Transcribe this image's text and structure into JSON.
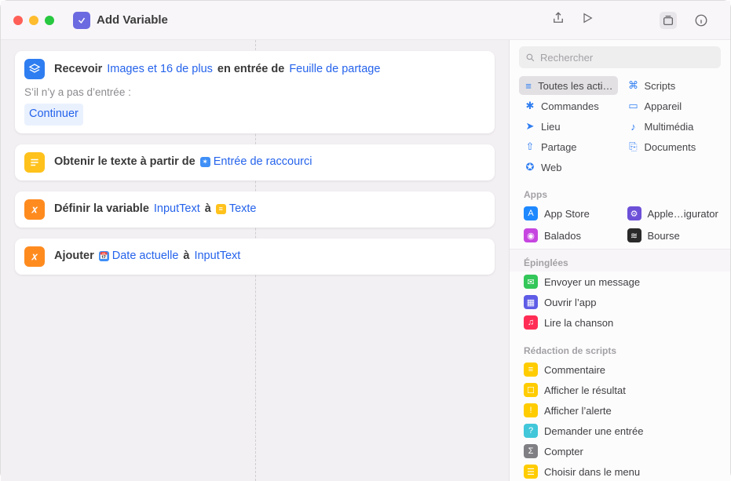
{
  "title": "Add Variable",
  "search": {
    "placeholder": "Rechercher"
  },
  "card_receive": {
    "verb": "Recevoir",
    "types": "Images et 16 de plus",
    "mid": "en entrée de",
    "source": "Feuille de partage",
    "noinput_label": "S’il n’y a pas d’entrée :",
    "noinput_action": "Continuer"
  },
  "card_gettext": {
    "verb": "Obtenir le texte à partir de",
    "input": "Entrée de raccourci"
  },
  "card_setvar": {
    "verb": "Définir la variable",
    "var": "InputText",
    "to": "à",
    "value": "Texte"
  },
  "card_add": {
    "verb": "Ajouter",
    "value": "Date actuelle",
    "to": "à",
    "var": "InputText"
  },
  "categories": [
    {
      "label": "Toutes les acti…",
      "icon": "≡",
      "active": true
    },
    {
      "label": "Scripts",
      "icon": "⌘"
    },
    {
      "label": "Commandes",
      "icon": "✱"
    },
    {
      "label": "Appareil",
      "icon": "▭"
    },
    {
      "label": "Lieu",
      "icon": "➤"
    },
    {
      "label": "Multimédia",
      "icon": "♪"
    },
    {
      "label": "Partage",
      "icon": "⇧"
    },
    {
      "label": "Documents",
      "icon": "⎘"
    },
    {
      "label": "Web",
      "icon": "✪"
    }
  ],
  "section_apps": "Apps",
  "apps": [
    {
      "label": "App Store",
      "icon": "A",
      "color": "#1e88ff"
    },
    {
      "label": "Apple…igurator",
      "icon": "⚙",
      "color": "#6d50d8"
    },
    {
      "label": "Balados",
      "icon": "◉",
      "color": "#c646e0"
    },
    {
      "label": "Bourse",
      "icon": "≋",
      "color": "#2a2a2b"
    }
  ],
  "section_pinned": "Épinglées",
  "pinned": [
    {
      "label": "Envoyer un message",
      "color": "#34c759",
      "glyph": "✉"
    },
    {
      "label": "Ouvrir l’app",
      "color": "#5e5ce6",
      "glyph": "▦"
    },
    {
      "label": "Lire la chanson",
      "color": "#ff2d55",
      "glyph": "♫"
    }
  ],
  "section_script": "Rédaction de scripts",
  "scripts": [
    {
      "label": "Commentaire",
      "color": "#ffcc00",
      "glyph": "≡"
    },
    {
      "label": "Afficher le résultat",
      "color": "#ffcc00",
      "glyph": "☐"
    },
    {
      "label": "Afficher l’alerte",
      "color": "#ffcc00",
      "glyph": "!"
    },
    {
      "label": "Demander une entrée",
      "color": "#41c7d9",
      "glyph": "?"
    },
    {
      "label": "Compter",
      "color": "#808084",
      "glyph": "Σ"
    },
    {
      "label": "Choisir dans le menu",
      "color": "#ffcc00",
      "glyph": "☰"
    }
  ]
}
